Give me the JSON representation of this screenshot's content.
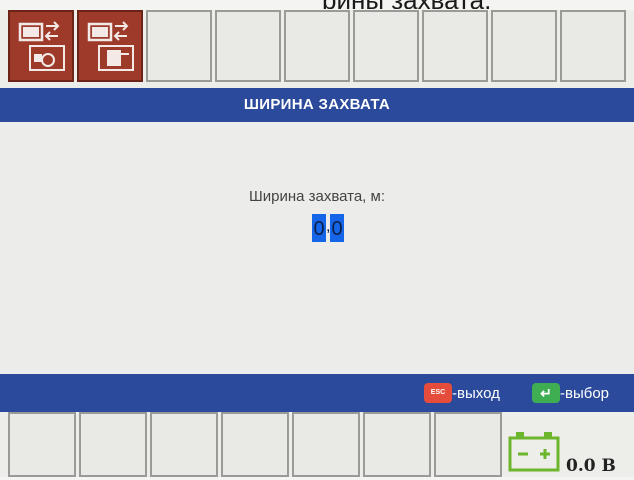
{
  "caption": "рины захвата.",
  "header": {
    "title": "ШИРИНА ЗАХВАТА"
  },
  "field": {
    "label": "Ширина захвата, м:",
    "digit_1": "0",
    "separator": ",",
    "digit_2": "0"
  },
  "status_bar": {
    "esc_key": "ESC",
    "exit_label": "-выход",
    "enter_key": "↵",
    "select_label": "-выбор"
  },
  "battery": {
    "reading": "0.0 В"
  },
  "colors": {
    "header": "#2b4a9c",
    "active_key": "#9d3a2a",
    "selection": "#1565e8"
  }
}
